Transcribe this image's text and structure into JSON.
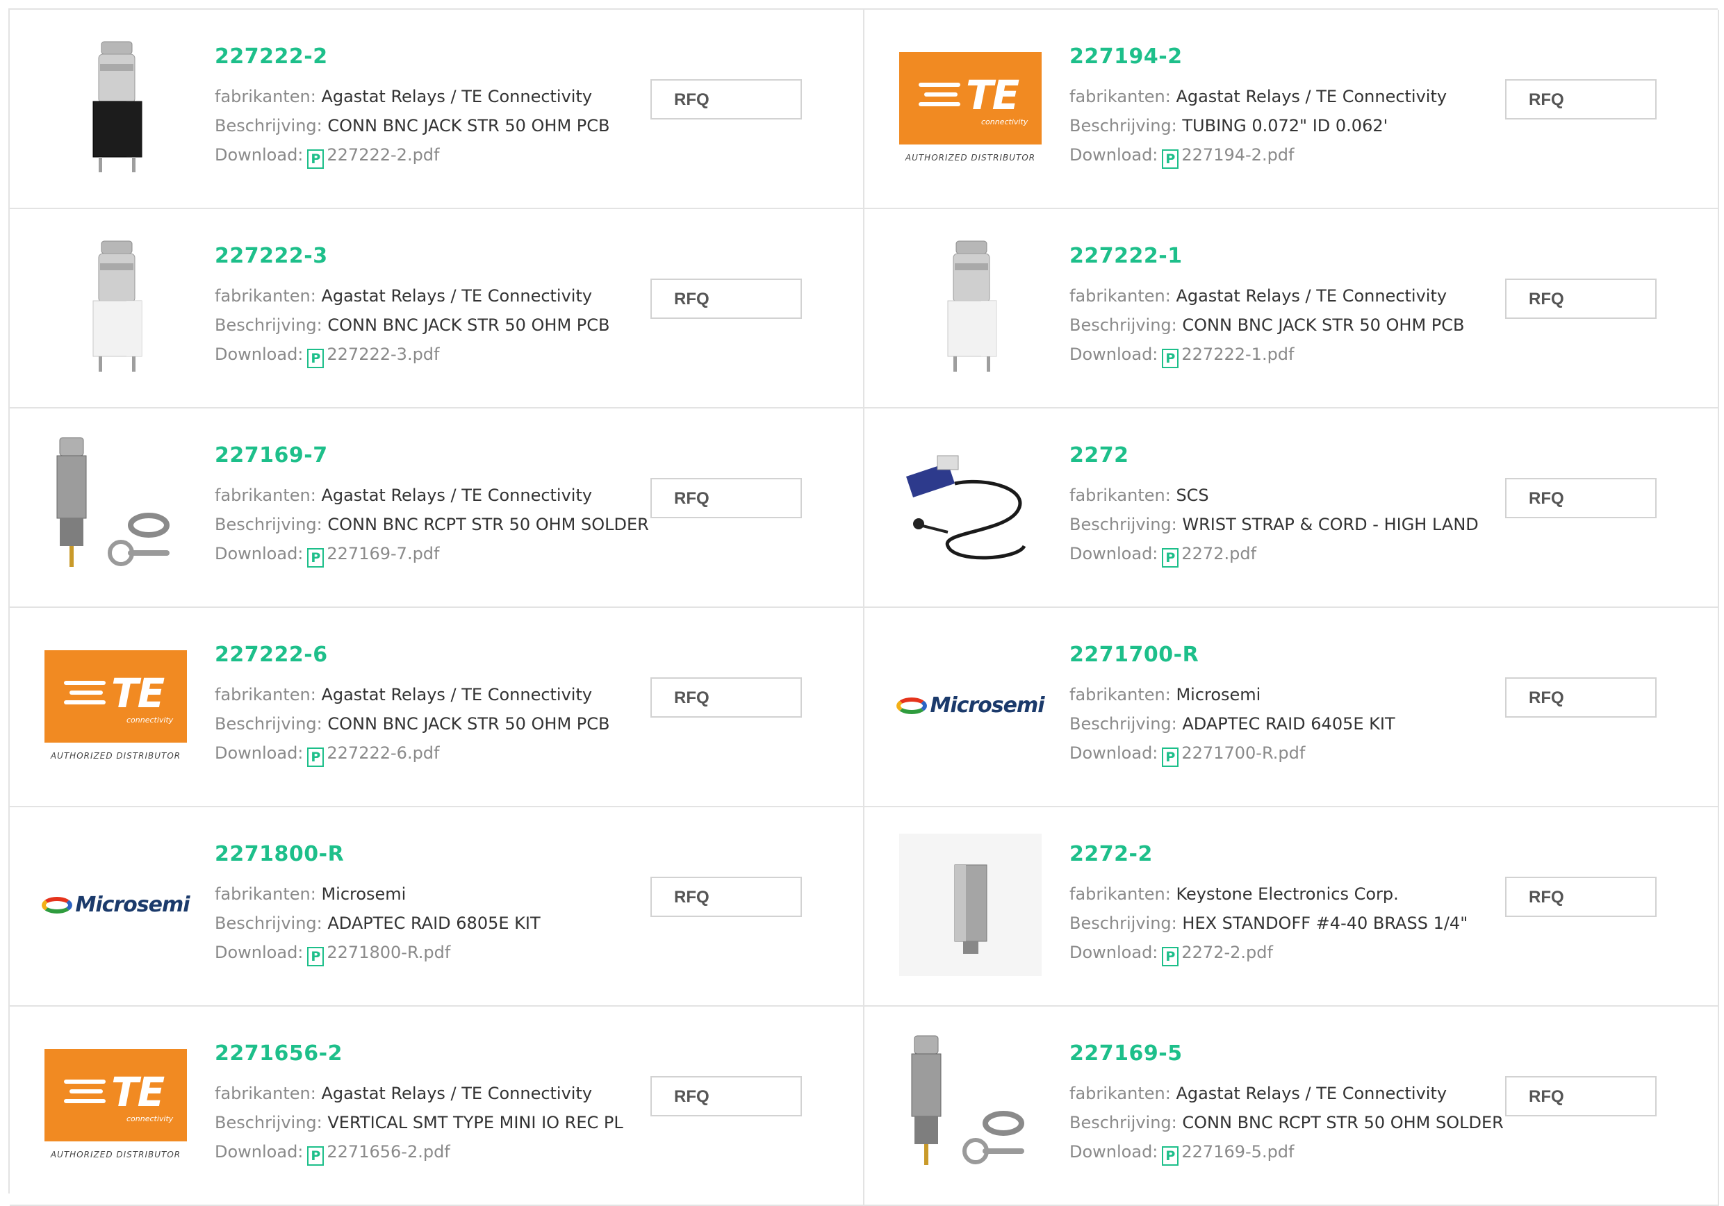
{
  "labels": {
    "manufacturer": "fabrikanten:",
    "description": "Beschrijving:",
    "download": "Download:",
    "rfq": "RFQ"
  },
  "logos": {
    "te_word": "TE",
    "te_sub": "connectivity",
    "te_authorized": "AUTHORIZED DISTRIBUTOR",
    "microsemi_word": "Microsemi"
  },
  "colors": {
    "accent_green": "#1dbf8a",
    "te_orange": "#f18a22"
  },
  "products": [
    {
      "part": "227222-2",
      "manufacturer": "Agastat Relays / TE Connectivity",
      "description": "CONN BNC JACK STR 50 OHM PCB",
      "file": "227222-2.pdf",
      "image": "bnc-black-connector"
    },
    {
      "part": "227194-2",
      "manufacturer": "Agastat Relays / TE Connectivity",
      "description": "TUBING 0.072\" ID 0.062'",
      "file": "227194-2.pdf",
      "image": "te-logo"
    },
    {
      "part": "227222-3",
      "manufacturer": "Agastat Relays / TE Connectivity",
      "description": "CONN BNC JACK STR 50 OHM PCB",
      "file": "227222-3.pdf",
      "image": "bnc-white-connector"
    },
    {
      "part": "227222-1",
      "manufacturer": "Agastat Relays / TE Connectivity",
      "description": "CONN BNC JACK STR 50 OHM PCB",
      "file": "227222-1.pdf",
      "image": "bnc-white-connector"
    },
    {
      "part": "227169-7",
      "manufacturer": "Agastat Relays / TE Connectivity",
      "description": "CONN BNC RCPT STR 50 OHM SOLDER",
      "file": "227169-7.pdf",
      "image": "bnc-receptacle-kit"
    },
    {
      "part": "2272",
      "manufacturer": "SCS",
      "description": "WRIST STRAP & CORD - HIGH LAND",
      "file": "2272.pdf",
      "image": "wrist-strap"
    },
    {
      "part": "227222-6",
      "manufacturer": "Agastat Relays / TE Connectivity",
      "description": "CONN BNC JACK STR 50 OHM PCB",
      "file": "227222-6.pdf",
      "image": "te-logo"
    },
    {
      "part": "2271700-R",
      "manufacturer": "Microsemi",
      "description": "ADAPTEC RAID 6405E KIT",
      "file": "2271700-R.pdf",
      "image": "microsemi-logo"
    },
    {
      "part": "2271800-R",
      "manufacturer": "Microsemi",
      "description": "ADAPTEC RAID 6805E KIT",
      "file": "2271800-R.pdf",
      "image": "microsemi-logo"
    },
    {
      "part": "2272-2",
      "manufacturer": "Keystone Electronics Corp.",
      "description": "HEX STANDOFF #4-40 BRASS 1/4\"",
      "file": "2272-2.pdf",
      "image": "hex-standoff"
    },
    {
      "part": "2271656-2",
      "manufacturer": "Agastat Relays / TE Connectivity",
      "description": "VERTICAL SMT TYPE MINI IO REC PL",
      "file": "2271656-2.pdf",
      "image": "te-logo"
    },
    {
      "part": "227169-5",
      "manufacturer": "Agastat Relays / TE Connectivity",
      "description": "CONN BNC RCPT STR 50 OHM SOLDER",
      "file": "227169-5.pdf",
      "image": "bnc-receptacle-kit"
    }
  ]
}
